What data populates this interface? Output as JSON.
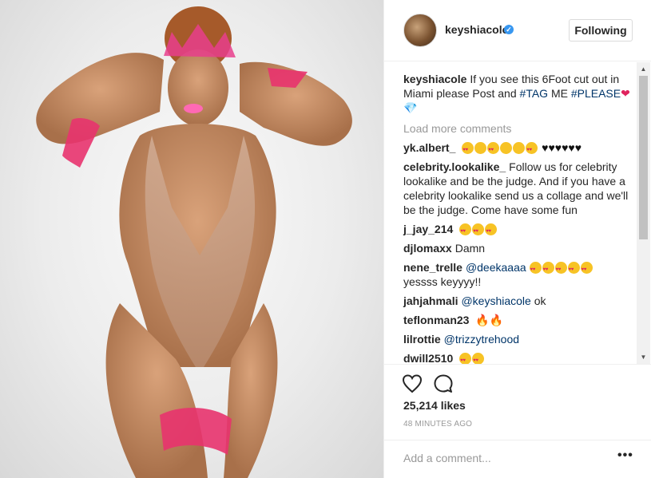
{
  "post": {
    "username": "keyshiacole",
    "verified_mark": "✓",
    "follow_label": "Following",
    "caption_user": "keyshiacole",
    "caption_text": "If you see this 6Foot cut out in Miami please Post and",
    "caption_tag1": "#TAG",
    "caption_me": "ME",
    "caption_tag2": "#PLEASE",
    "load_more": "Load more comments",
    "likes": "25,214 likes",
    "time": "48 MINUTES AGO",
    "add_comment_placeholder": "Add a comment...",
    "more_label": "•••"
  },
  "comments": [
    {
      "user": "yk.albert_",
      "text": ""
    },
    {
      "user": "celebrity.lookalike_",
      "text": "Follow us for celebrity lookalike and be the judge. And if you have a celebrity lookalike send us a collage and we'll be the judge. Come have some fun"
    },
    {
      "user": "j_jay_214",
      "text": ""
    },
    {
      "user": "djlomaxx",
      "text": "Damn"
    },
    {
      "user": "nene_trelle",
      "mention": "@deekaaaa",
      "text2": "yessss keyyyy!!"
    },
    {
      "user": "jahjahmali",
      "mention": "@keyshiacole",
      "text": "ok"
    },
    {
      "user": "teflonman23",
      "text": ""
    },
    {
      "user": "lilrottie",
      "mention": "@trizzytrehood"
    },
    {
      "user": "dwill2510",
      "text": ""
    }
  ],
  "icons": {
    "like": "heart-outline-icon",
    "comment": "speech-bubble-icon",
    "scroll_up": "scroll-up-arrow-icon",
    "scroll_down": "scroll-down-arrow-icon"
  },
  "colors": {
    "verified": "#3897f0",
    "link": "#003569",
    "muted": "#999999",
    "border": "#efefef"
  }
}
